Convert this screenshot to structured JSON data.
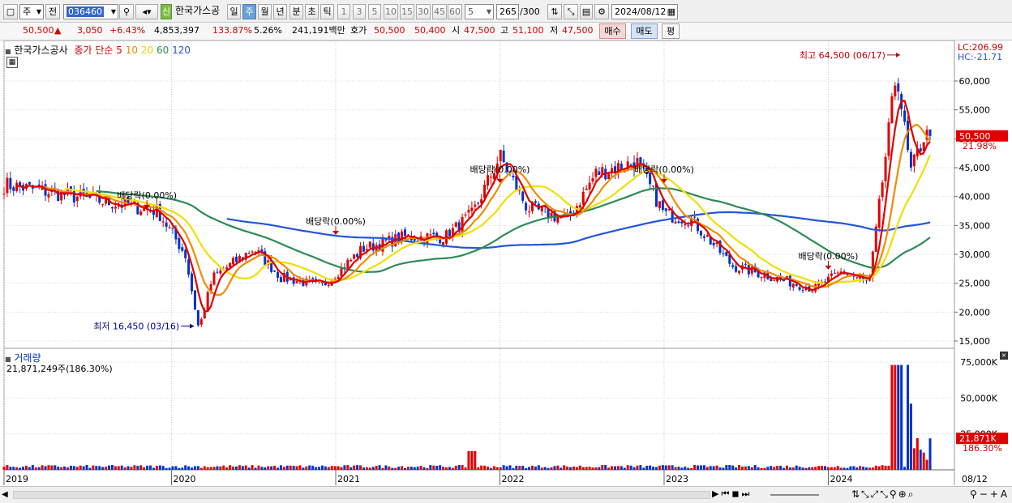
{
  "toolbar": {
    "period_select": "주",
    "type_select": "전",
    "code": "036460",
    "new_badge": "신",
    "stock_name": "한국가스공",
    "periods": [
      "일",
      "주",
      "월",
      "년",
      "분",
      "초",
      "틱"
    ],
    "selected_period": "주",
    "intervals": [
      "1",
      "3",
      "5",
      "10",
      "15",
      "30",
      "45",
      "60"
    ],
    "interval_value": "5",
    "count": "265",
    "count_total": "/300",
    "date": "2024/08/12"
  },
  "quote": {
    "price": "50,500",
    "direction": "▲",
    "change": "3,050",
    "change_pct": "+6.43%",
    "volume": "4,853,397",
    "volume_ratio": "133.87%",
    "turnover": "5.26%",
    "amount": "241,191백만",
    "ask_label": "호가",
    "ask": "50,500",
    "bid": "50,400",
    "open_label": "시",
    "open": "47,500",
    "high_label": "고",
    "high": "51,100",
    "low_label": "저",
    "low": "47,500",
    "buy_button": "매수",
    "sell_button": "매도",
    "eval_button": "평"
  },
  "price_panel": {
    "stock_label": "한국가스공사",
    "ma_label": "종가 단순",
    "ma_periods": [
      {
        "label": "5",
        "color": "#e00000"
      },
      {
        "label": "10",
        "color": "#f08c00"
      },
      {
        "label": "20",
        "color": "#f0e000"
      },
      {
        "label": "60",
        "color": "#2e8b57"
      },
      {
        "label": "120",
        "color": "#2255dd"
      }
    ],
    "lc": "LC:206.99",
    "hc": "HC:-21.71",
    "current_price_label": "50,500",
    "current_pct_label": "21.98%",
    "high_annotation": "최고 64,500 (06/17)",
    "low_annotation": "최저 16,450 (03/16)",
    "dividend_label": "배당락(0.00%)",
    "y_ticks": [
      "60,000",
      "55,000",
      "50,000",
      "45,000",
      "40,000",
      "35,000",
      "30,000",
      "25,000",
      "20,000",
      "15,000"
    ]
  },
  "volume_panel": {
    "title": "거래량",
    "summary": "21,871,249주(186.30%)",
    "y_ticks": [
      "75,000K",
      "50,000K",
      "25,000K"
    ],
    "current_label": "21,871K",
    "current_pct": "186.30%"
  },
  "x_axis": {
    "labels": [
      "2019",
      "2020",
      "2021",
      "2022",
      "2023",
      "2024"
    ],
    "end_label": "08/12"
  },
  "colors": {
    "up": "#e00000",
    "down": "#0032c8",
    "ma5": "#e00000",
    "ma10": "#f08c00",
    "ma20": "#f0e000",
    "ma60": "#2e8b57",
    "ma120": "#2255dd"
  },
  "chart_data": {
    "type": "candlestick",
    "interval": "weekly",
    "x_range": [
      "2019",
      "2024/08/12"
    ],
    "price_ylim": [
      15000,
      65000
    ],
    "volume_ylim": [
      0,
      75000000
    ],
    "close_series": [
      [
        "2019",
        42000
      ],
      [
        "2019-06",
        40000
      ],
      [
        "2019-12",
        37500
      ],
      [
        "2020-02",
        30000
      ],
      [
        "2020-03",
        17000
      ],
      [
        "2020-04",
        26000
      ],
      [
        "2020-07",
        31000
      ],
      [
        "2020-09",
        26000
      ],
      [
        "2020-12",
        24500
      ],
      [
        "2021-03",
        31000
      ],
      [
        "2021-06",
        33000
      ],
      [
        "2021-09",
        33000
      ],
      [
        "2021-11",
        37000
      ],
      [
        "2022-01",
        47000
      ],
      [
        "2022-03",
        38000
      ],
      [
        "2022-06",
        36000
      ],
      [
        "2022-08",
        44000
      ],
      [
        "2022-11",
        46000
      ],
      [
        "2023-01",
        37000
      ],
      [
        "2023-03",
        36000
      ],
      [
        "2023-06",
        28000
      ],
      [
        "2023-09",
        26000
      ],
      [
        "2023-12",
        24000
      ],
      [
        "2024-02",
        27000
      ],
      [
        "2024-04",
        25000
      ],
      [
        "2024-06",
        62000
      ],
      [
        "2024-07",
        44000
      ],
      [
        "2024-08",
        50500
      ]
    ],
    "high": {
      "value": 64500,
      "date": "06/17"
    },
    "low": {
      "value": 16450,
      "date": "03/16"
    },
    "volume_spikes": [
      [
        "2021-11",
        13000000
      ],
      [
        "2024-06",
        73000000
      ],
      [
        "2024-07",
        46000000
      ],
      [
        "2024-08",
        21871249
      ]
    ]
  }
}
